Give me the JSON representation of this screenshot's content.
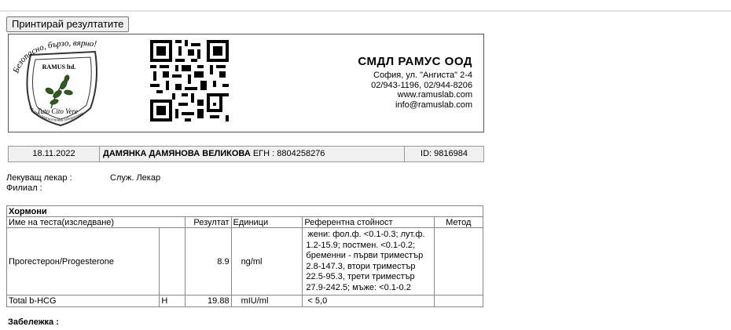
{
  "toolbar": {
    "print_label": "Принтирай резултатите"
  },
  "lab": {
    "logo_text_top": "Безопасно, бързо, вярно!",
    "logo_company": "RAMUS ltd.",
    "logo_motto": "Tuto Cito Vere",
    "logo_bottom": "Медико-диагностична лаборатория",
    "name": "СМДЛ РАМУС ООД",
    "address": "София, ул. \"Ангиста\" 2-4",
    "phones": "02/943-1196, 02/944-8206",
    "website": "www.ramuslab.com",
    "email": "info@ramuslab.com"
  },
  "patient": {
    "date": "18.11.2022",
    "name": "ДАМЯНКА ДАМЯНОВА ВЕЛИКОВА",
    "egn_label": "ЕГН : 8804258276",
    "id_label": "ID: 9816984"
  },
  "doctor": {
    "label": "Лекуващ лекар :",
    "value": "Служ. Лекар",
    "branch_label": "Филиал :",
    "branch_value": ""
  },
  "results": {
    "group_title": "Хормони",
    "headers": {
      "name": "Име на теста(изследване)",
      "result": "Резултат",
      "unit": "Единици",
      "reference": "Референтна стойност",
      "method": "Метод"
    },
    "rows": [
      {
        "name": "Прогестерон/Progesterone",
        "flag": "",
        "result": "8.9",
        "unit": "ng/ml",
        "reference_lines": [
          "жени: фол.ф. <0.1-0.3; лут.ф.",
          "1.2-15.9; постмен. <0.1-0.2;",
          "бременни - първи триместър",
          "2.8-147.3, втори триместър",
          "22.5-95.3, трети триместър",
          "27.9-242.5; мъже: <0.1-0.2"
        ],
        "method": ""
      },
      {
        "name": "Total b-HCG",
        "flag": "H",
        "result": "19.88",
        "unit": "mIU/ml",
        "reference": "< 5,0",
        "method": ""
      }
    ]
  },
  "note": {
    "label": "Забележка :"
  }
}
